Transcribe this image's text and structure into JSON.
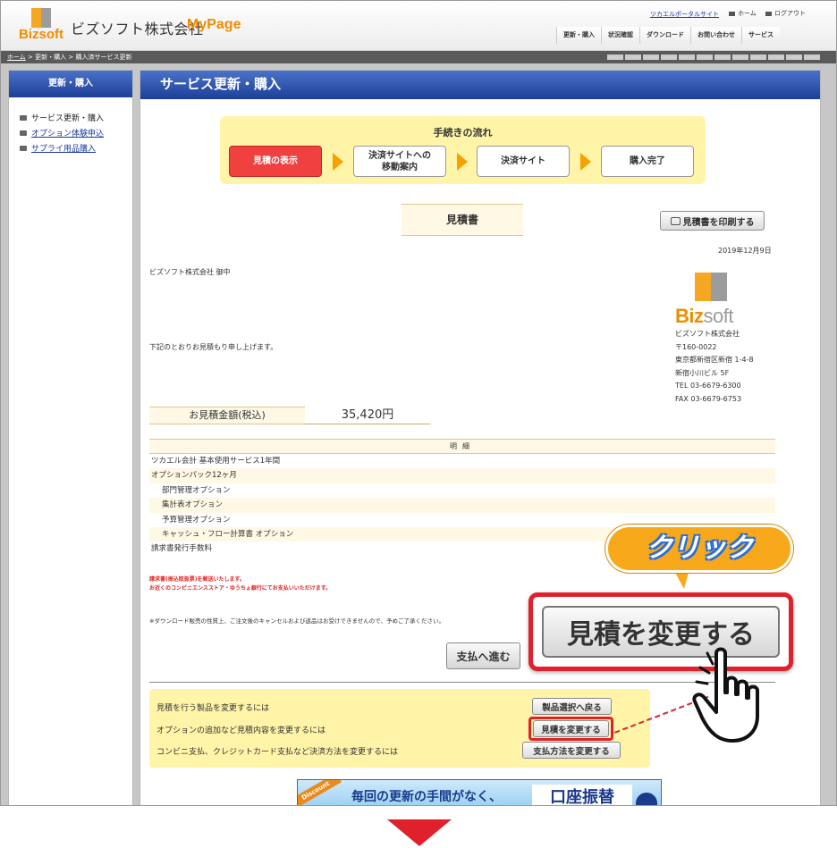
{
  "header": {
    "logo_text": "Bizsoft",
    "company": "ビズソフト株式会社",
    "product": "MyPage",
    "portal_link": "ツカエルポータルサイト",
    "home": "ホーム",
    "logout": "ログアウト",
    "nav": [
      "更新・購入",
      "状況確認",
      "ダウンロード",
      "お問い合わせ",
      "サービス"
    ]
  },
  "breadcrumb": {
    "home": "ホーム",
    "sep": ">",
    "level1": "更新・購入",
    "level2": "購入済サービス更新"
  },
  "sidebar": {
    "title": "更新・購入",
    "items": [
      {
        "label": "サービス更新・購入",
        "link": false
      },
      {
        "label": "オプション体験申込",
        "link": true
      },
      {
        "label": "サプライ用品購入",
        "link": true
      }
    ]
  },
  "main": {
    "title": "サービス更新・購入",
    "flow": {
      "title": "手続きの流れ",
      "steps": [
        {
          "line1": "見積の表示",
          "line2": ""
        },
        {
          "line1": "決済サイトへの",
          "line2": "移動案内"
        },
        {
          "line1": "決済サイト",
          "line2": ""
        },
        {
          "line1": "購入完了",
          "line2": ""
        }
      ]
    },
    "estimate_title": "見積書",
    "print_button": "見積書を印刷する",
    "date": "2019年12月9日",
    "addressee": "ビズソフト株式会社 御中",
    "intro": "下記のとおりお見積もり申し上げます。",
    "issuer": {
      "logo_main": "Biz",
      "logo_sub": "soft",
      "lines": [
        "ビズソフト株式会社",
        "〒160-0022",
        "東京都新宿区新宿 1-4-8",
        "新宿小川ビル 5F",
        "TEL 03-6679-6300",
        "FAX 03-6679-6753"
      ]
    },
    "amount_label": "お見積金額(税込)",
    "amount_value": "35,420円",
    "detail_header": "明細",
    "detail_rows": [
      {
        "label": "ツカエル会計 基本使用サービス1年間",
        "indent": false,
        "alt": false
      },
      {
        "label": "オプションパック12ヶ月",
        "indent": false,
        "alt": true
      },
      {
        "label": "部門管理オプション",
        "indent": true,
        "alt": false
      },
      {
        "label": "集計表オプション",
        "indent": true,
        "alt": true
      },
      {
        "label": "予算管理オプション",
        "indent": true,
        "alt": false
      },
      {
        "label": "キャッシュ・フロー計算書 オプション",
        "indent": true,
        "alt": true
      },
      {
        "label": "請求書発行手数料",
        "indent": false,
        "alt": false
      }
    ],
    "red_note_1": "請求書(振込取扱票)を郵送いたします。",
    "red_note_2": "お近くのコンビニエンスストア・ゆうちょ銀行にてお支払いいただけます。",
    "download_note": "※ダウンロード販売の性質上、ご注文後のキャンセルおよび返品はお受けできませんので、予めご了承ください。",
    "pay_button": "支払へ進む",
    "change": {
      "row1_text": "見積を行う製品を変更するには",
      "row1_button": "製品選択へ戻る",
      "row2_text": "オプションの追加など見積内容を変更するには",
      "row2_button": "見積を変更する",
      "row3_text": "コンビニ支払、クレジットカード支払など決済方法を変更するには",
      "row3_button": "支払方法を変更する"
    },
    "banner": {
      "ribbon": "Discount",
      "text": "毎回の更新の手間がなく、",
      "tag": "口座振替"
    }
  },
  "callout": {
    "bubble": "クリック",
    "zoom_button": "見積を変更する"
  },
  "colors": {
    "accent_blue": "#1d3f97",
    "accent_red": "#e0212b",
    "flow_yellow": "#fff4a8",
    "bubble_orange": "#f7a81b"
  }
}
